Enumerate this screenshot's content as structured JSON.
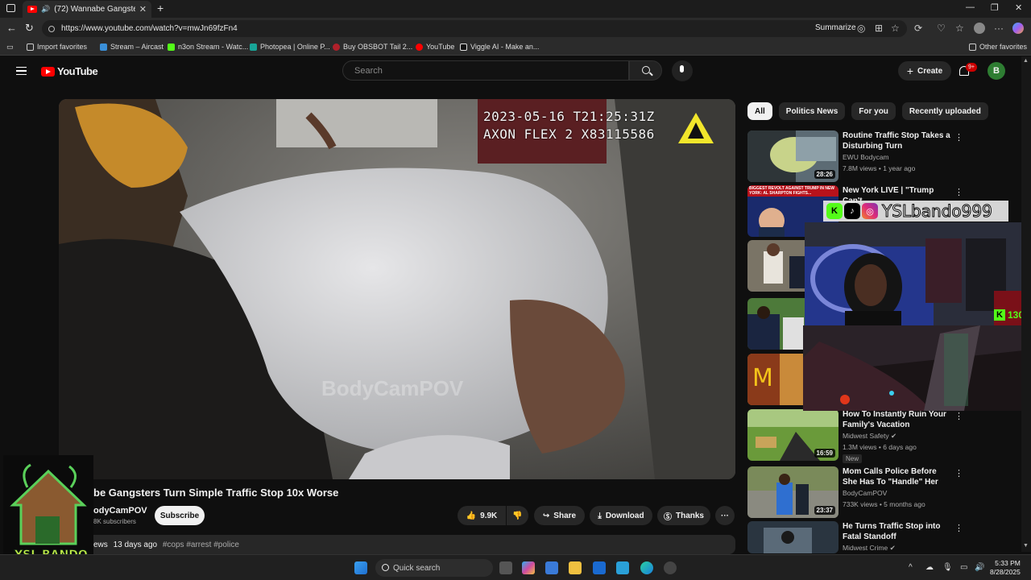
{
  "browser": {
    "tab_title": "(72) Wannabe Gangsters Tu",
    "url": "https://www.youtube.com/watch?v=mwJn69fzFn4",
    "summarize_label": "Summarize",
    "bookmarks": [
      "Import favorites",
      "Stream – Aircast",
      "n3on Stream - Watc...",
      "Photopea | Online P...",
      "Buy OBSBOT Tail 2...",
      "YouTube",
      "Viggle AI - Make an..."
    ],
    "other_favorites": "Other favorites"
  },
  "youtube": {
    "logo_text": "YouTube",
    "search_placeholder": "Search",
    "create_label": "Create",
    "notif_badge": "9+",
    "avatar_letter": "B"
  },
  "video": {
    "timestamp": "2023-05-16  T21:25:31Z",
    "camera_id": "AXON FLEX 2 X83115586",
    "watermark": "BodyCamPOV",
    "title": "be Gangsters Turn Simple Traffic Stop 10x Worse",
    "channel": "odyCamPOV",
    "subscribers": "8K subscribers",
    "subscribe_label": "Subscribe",
    "likes": "9.9K",
    "share_label": "Share",
    "download_label": "Download",
    "thanks_label": "Thanks",
    "views_fragment": "ews",
    "age": "13 days ago",
    "tags": "#cops #arrest #police"
  },
  "chips": [
    "All",
    "Politics News",
    "For you",
    "Recently uploaded"
  ],
  "recommendations": [
    {
      "title": "Routine Traffic Stop Takes a Disturbing Turn",
      "channel": "EWU Bodycam",
      "meta": "7.8M views • 1 year ago",
      "duration": "28:26",
      "new": ""
    },
    {
      "title": "New York LIVE | \"Trump Can't",
      "channel": "",
      "meta": "",
      "duration": "",
      "new": ""
    },
    {
      "title": "How To Instantly Ruin Your Family's Vacation",
      "channel": "Midwest Safety",
      "meta": "1.3M views • 6 days ago",
      "duration": "16:59",
      "new": "New"
    },
    {
      "title": "Mom Calls Police Before She Has To \"Handle\" Her Kids ...",
      "channel": "BodyCamPOV",
      "meta": "733K views • 5 months ago",
      "duration": "23:37",
      "new": ""
    },
    {
      "title": "He Turns Traffic Stop into Fatal Standoff",
      "channel": "Midwest Crime",
      "meta": "",
      "duration": "",
      "new": ""
    }
  ],
  "thumb_overlay_text": "BIGGEST REVOLT AGAINST TRUMP IN NEW YORK: AL SHARPTON FIGHTS...",
  "overlay": {
    "handle": "YSLbando999",
    "kick_count": "130",
    "logo_text": "YSL BANDO"
  },
  "taskbar": {
    "search_label": "Quick search",
    "time": "5:33 PM",
    "date": "8/28/2025"
  }
}
